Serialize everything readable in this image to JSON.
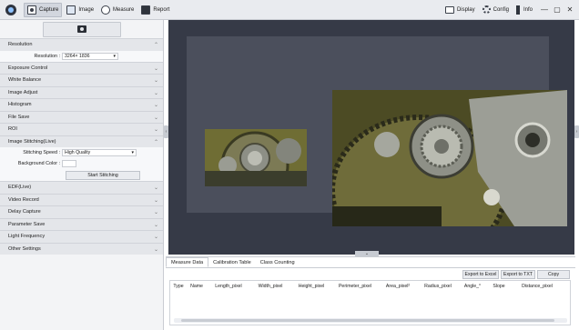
{
  "toolbar": {
    "items": [
      {
        "label": "Capture",
        "icon": "capture-icon",
        "active": true
      },
      {
        "label": "Image",
        "icon": "image-icon",
        "active": false
      },
      {
        "label": "Measure",
        "icon": "measure-icon",
        "active": false
      },
      {
        "label": "Report",
        "icon": "report-icon",
        "active": false
      }
    ],
    "right": [
      {
        "label": "Display",
        "icon": "display-icon"
      },
      {
        "label": "Config",
        "icon": "gear-icon"
      },
      {
        "label": "Info",
        "icon": "info-icon"
      }
    ],
    "window_controls": [
      "—",
      "▢",
      "✕"
    ]
  },
  "left_panel": {
    "sections": [
      {
        "label": "Resolution",
        "expanded": true
      },
      {
        "label": "Exposure Control"
      },
      {
        "label": "White Balance"
      },
      {
        "label": "Image Adjust"
      },
      {
        "label": "Histogram"
      },
      {
        "label": "File Save"
      },
      {
        "label": "ROI"
      },
      {
        "label": "Image Stitching(Live)",
        "expanded": true
      },
      {
        "label": "EDF(Live)"
      },
      {
        "label": "Video Record"
      },
      {
        "label": "Delay Capture"
      },
      {
        "label": "Parameter Save"
      },
      {
        "label": "Light Frequency"
      },
      {
        "label": "Other Settings"
      }
    ],
    "resolution": {
      "label": "Resolution :",
      "value": "3264× 1836"
    },
    "stitching": {
      "speed_label": "Stitching Speed :",
      "speed_value": "High Quality",
      "bg_label": "Background Color :",
      "start_button": "Start Stitching"
    }
  },
  "measure": {
    "tabs": [
      "Measure Data",
      "Calibration Table",
      "Class Counting"
    ],
    "buttons": [
      "Export to Excel",
      "Export to TXT",
      "Copy"
    ],
    "columns": [
      "Type",
      "Name",
      "Length_pixel",
      "Width_pixel",
      "Height_pixel",
      "Perimeter_pixel",
      "Area_pixel²",
      "Radius_pixel",
      "Angle_°",
      "Slope",
      "Distance_pixel"
    ]
  },
  "colors": {
    "viewer_bg": "#363a47",
    "canvas_bg": "#4b4f5c",
    "panel_bg": "#f3f4f6"
  }
}
